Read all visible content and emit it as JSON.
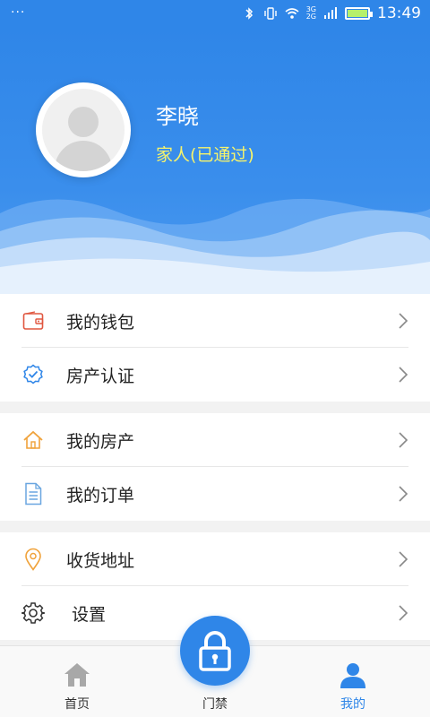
{
  "status_bar": {
    "time": "13:49",
    "network_top": "3G",
    "network_bottom": "2G",
    "left_dots": "···"
  },
  "profile": {
    "name": "李晓",
    "role": "家人(已通过)"
  },
  "menu_groups": [
    {
      "items": [
        {
          "label": "我的钱包",
          "icon": "wallet-icon",
          "color": "#e0563f"
        },
        {
          "label": "房产认证",
          "icon": "verified-badge-icon",
          "color": "#2f86e8"
        }
      ]
    },
    {
      "items": [
        {
          "label": "我的房产",
          "icon": "house-icon",
          "color": "#f0a23a"
        },
        {
          "label": "我的订单",
          "icon": "document-list-icon",
          "color": "#6aa6e0"
        }
      ]
    },
    {
      "items": [
        {
          "label": "收货地址",
          "icon": "location-pin-icon",
          "color": "#f0a23a"
        },
        {
          "label": "设置",
          "icon": "gear-icon",
          "color": "#333333"
        }
      ]
    }
  ],
  "bottom_nav": {
    "home": "首页",
    "door": "门禁",
    "me": "我的"
  },
  "colors": {
    "primary": "#2f86e8",
    "role_text": "#f6f36b"
  }
}
